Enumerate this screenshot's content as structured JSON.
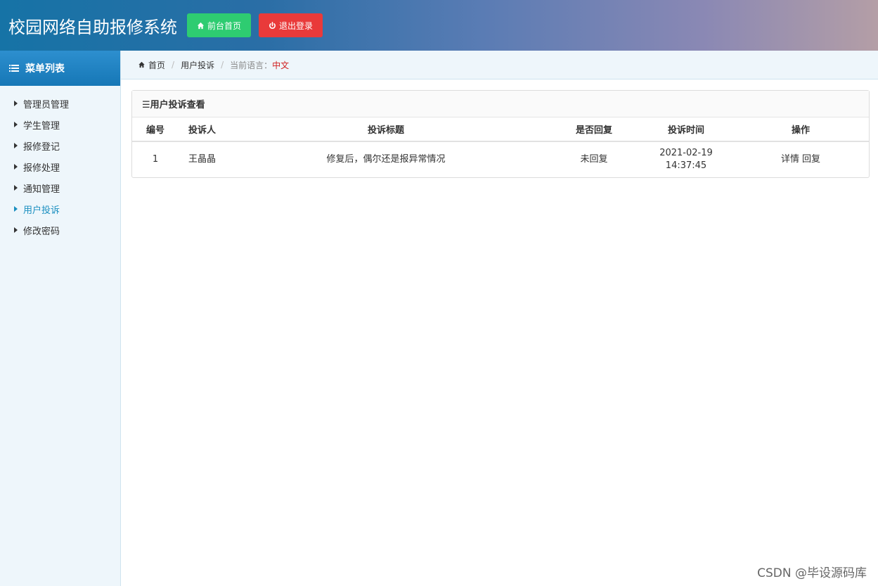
{
  "header": {
    "title": "校园网络自助报修系统",
    "home_button": "前台首页",
    "logout_button": "退出登录"
  },
  "sidebar": {
    "heading": "菜单列表",
    "items": [
      {
        "label": "管理员管理"
      },
      {
        "label": "学生管理"
      },
      {
        "label": "报修登记"
      },
      {
        "label": "报修处理"
      },
      {
        "label": "通知管理"
      },
      {
        "label": "用户投诉",
        "active": true
      },
      {
        "label": "修改密码"
      }
    ]
  },
  "breadcrumb": {
    "home": "首页",
    "current": "用户投诉",
    "lang_label": "当前语言：",
    "lang_value": "中文"
  },
  "panel": {
    "title": "☰用户投诉查看",
    "columns": [
      "编号",
      "投诉人",
      "投诉标题",
      "是否回复",
      "投诉时间",
      "操作"
    ],
    "rows": [
      {
        "id": "1",
        "user": "王晶晶",
        "title": "修复后，偶尔还是报异常情况",
        "reply_status": "未回复",
        "date": "2021-02-19",
        "time": "14:37:45",
        "action_detail": "详情",
        "action_reply": "回复"
      }
    ]
  },
  "watermark": "CSDN @毕设源码库",
  "colors": {
    "accent": "#1a7fc0",
    "green_button": "#2ecc71",
    "red_button": "#e93a3a",
    "lang_value": "#d01f1f"
  }
}
